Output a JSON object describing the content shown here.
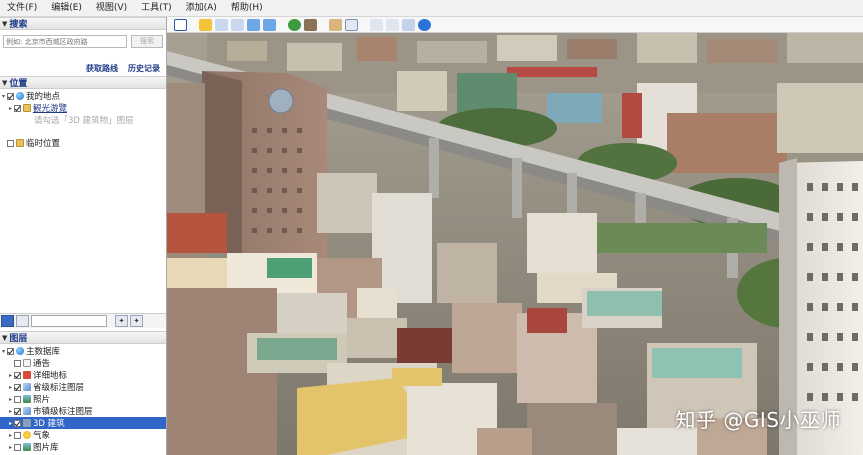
{
  "menubar": {
    "items": [
      "文件(F)",
      "编辑(E)",
      "视图(V)",
      "工具(T)",
      "添加(A)",
      "帮助(H)"
    ]
  },
  "search": {
    "header": "搜索",
    "placeholder": "例如: 北京市西城区政府路",
    "button_label": "搜索",
    "link_directions": "获取路线",
    "link_history": "历史记录"
  },
  "places": {
    "header": "位置",
    "items": [
      {
        "label": "我的地点",
        "style": "normal",
        "checked": true,
        "icon": "globe-icon"
      },
      {
        "label": "観光游覽",
        "style": "link",
        "checked": true,
        "icon": "folder-icon"
      },
      {
        "label": "请勾选「3D 建筑物」图层",
        "style": "hint",
        "checked": false,
        "icon": ""
      },
      {
        "label": "临时位置",
        "style": "normal",
        "checked": false,
        "icon": "folder-icon"
      }
    ]
  },
  "layers": {
    "header": "图层",
    "items": [
      {
        "label": "主数据库",
        "checked": true,
        "icon": "globe-icon",
        "selected": false
      },
      {
        "label": "通告",
        "checked": false,
        "icon": "doc-icon",
        "selected": false
      },
      {
        "label": "详细地标",
        "checked": true,
        "icon": "flag-icon",
        "selected": false
      },
      {
        "label": "省级标注图层",
        "checked": true,
        "icon": "layer-icon",
        "selected": false
      },
      {
        "label": "照片",
        "checked": false,
        "icon": "image-icon",
        "selected": false
      },
      {
        "label": "市镇级标注图层",
        "checked": true,
        "icon": "layer-icon",
        "selected": false
      },
      {
        "label": "3D 建筑",
        "checked": true,
        "icon": "building-icon",
        "selected": true
      },
      {
        "label": "气象",
        "checked": false,
        "icon": "weather-icon",
        "selected": false
      },
      {
        "label": "图片库",
        "checked": false,
        "icon": "image-icon",
        "selected": false
      }
    ]
  },
  "toolbar": {
    "icons": [
      "hide-sidebar-icon",
      "placemark-icon",
      "polygon-icon",
      "path-icon",
      "image-overlay-icon",
      "record-tour-icon",
      "historical-imagery-icon",
      "sunlight-icon",
      "planets-icon",
      "ruler-icon",
      "email-icon",
      "print-icon",
      "save-image-icon",
      "maps-icon"
    ]
  },
  "view": {
    "watermark": "知乎 @GIS小巫师"
  },
  "colors": {
    "accent_blue": "#1f3a8a",
    "selection": "#2f66c7"
  }
}
